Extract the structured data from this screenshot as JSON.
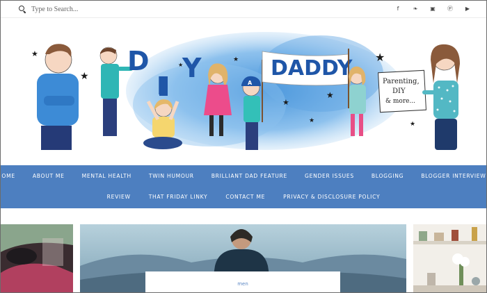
{
  "search": {
    "placeholder": "Type to Search..."
  },
  "social": [
    {
      "icon": "facebook-icon",
      "glyph": "f"
    },
    {
      "icon": "twitter-icon",
      "glyph": "❧"
    },
    {
      "icon": "instagram-icon",
      "glyph": "▣"
    },
    {
      "icon": "pinterest-icon",
      "glyph": "Ⓟ"
    },
    {
      "icon": "youtube-icon",
      "glyph": "▶"
    }
  ],
  "header": {
    "logo_letters": [
      "D",
      "I",
      "Y",
      "DADDY"
    ],
    "sign_text": [
      "Parenting,",
      "DIY",
      "& more..."
    ]
  },
  "nav": {
    "row1": [
      "HOME",
      "ABOUT ME",
      "MENTAL HEALTH",
      "TWIN HUMOUR",
      "BRILLIANT DAD FEATURE",
      "GENDER ISSUES",
      "BLOGGING",
      "BLOGGER INTERVIEWS"
    ],
    "row2": [
      "REVIEW",
      "THAT FRIDAY LINKY",
      "CONTACT ME",
      "PRIVACY & DISCLOSURE POLICY"
    ]
  },
  "posts": {
    "featured_category": "men"
  },
  "colors": {
    "nav_bg": "#4d7fc0",
    "logo_blue": "#1f56a8",
    "watercolor": "#6aa9e0"
  }
}
